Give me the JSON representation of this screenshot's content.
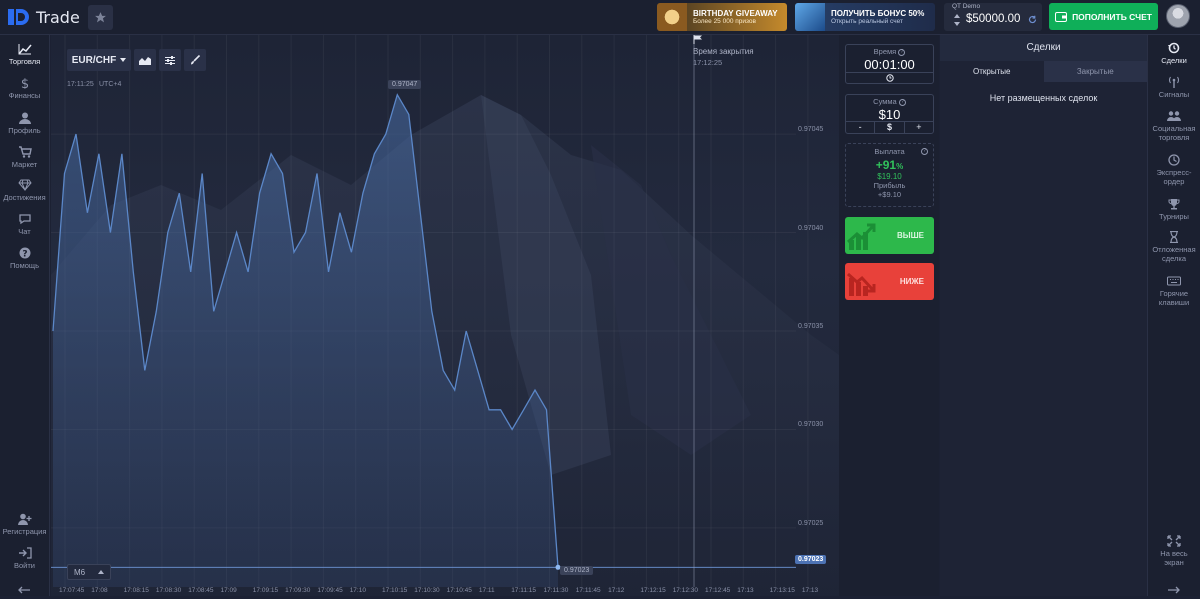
{
  "header": {
    "logo_text": "Trade",
    "promo1": {
      "title": "BIRTHDAY GIVEAWAY",
      "subtitle": "Более 25 000 призов"
    },
    "promo2": {
      "title": "ПОЛУЧИТЬ БОНУС 50%",
      "subtitle": "Открыть реальный счет"
    },
    "account_type": "QT Demo",
    "balance": "$50000.00",
    "deposit_label": "ПОПОЛНИТЬ СЧЕТ"
  },
  "left_nav": [
    {
      "label": "Торговля",
      "icon": "chart-icon",
      "active": true
    },
    {
      "label": "Финансы",
      "icon": "dollar-icon"
    },
    {
      "label": "Профиль",
      "icon": "user-icon"
    },
    {
      "label": "Маркет",
      "icon": "cart-icon"
    },
    {
      "label": "Достижения",
      "icon": "diamond-icon"
    },
    {
      "label": "Чат",
      "icon": "chat-icon"
    },
    {
      "label": "Помощь",
      "icon": "help-icon"
    }
  ],
  "left_nav_bottom": [
    {
      "label": "Регистрация",
      "icon": "user-plus-icon"
    },
    {
      "label": "Войти",
      "icon": "login-icon"
    }
  ],
  "chart": {
    "asset": "EUR/CHF",
    "time": "17:11:25",
    "timezone": "UTC+4",
    "close_label": "Время закрытия",
    "close_time": "17:12:25",
    "high_tag": "0.97047",
    "low_tag": "0.97023",
    "current_price": "0.97023",
    "timeframe": "M6",
    "y_ticks": [
      "0.97045",
      "0.97040",
      "0.97035",
      "0.97030",
      "0.97025"
    ],
    "x_ticks": [
      "17:07:45",
      "17:08",
      "17:08:15",
      "17:08:30",
      "17:08:45",
      "17:09",
      "17:09:15",
      "17:09:30",
      "17:09:45",
      "17:10",
      "17:10:15",
      "17:10:30",
      "17:10:45",
      "17:11",
      "17:11:15",
      "17:11:30",
      "17:11:45",
      "17:12",
      "17:12:15",
      "17:12:30",
      "17:12:45",
      "17:13",
      "17:13:15",
      "17:13"
    ]
  },
  "chart_data": {
    "type": "area",
    "title": "EUR/CHF",
    "ylim": [
      0.97022,
      0.97048
    ],
    "series": [
      {
        "values": [
          0.97035,
          0.97043,
          0.97045,
          0.97041,
          0.97044,
          0.9704,
          0.97044,
          0.97038,
          0.97033,
          0.97036,
          0.9704,
          0.97042,
          0.97038,
          0.97043,
          0.97036,
          0.97038,
          0.9704,
          0.97038,
          0.97042,
          0.97044,
          0.97043,
          0.97039,
          0.9704,
          0.97043,
          0.97038,
          0.97041,
          0.97039,
          0.97042,
          0.97044,
          0.97045,
          0.97047,
          0.97046,
          0.97041,
          0.97036,
          0.97033,
          0.97032,
          0.97035,
          0.97033,
          0.97031,
          0.97031,
          0.9703,
          0.97031,
          0.97032,
          0.97031,
          0.97023
        ]
      }
    ]
  },
  "trade_panel": {
    "time_label": "Время",
    "time_value": "00:01:00",
    "amount_label": "Сумма",
    "amount_value": "$10",
    "minus": "-",
    "currency": "$",
    "plus": "+",
    "payout_label": "Выплата",
    "payout_percent": "+91",
    "payout_pct_sign": "%",
    "payout_amount": "$19.10",
    "profit_label": "Прибыль",
    "profit_value": "+$9.10",
    "up_label": "ВЫШЕ",
    "down_label": "НИЖЕ"
  },
  "deals": {
    "title": "Сделки",
    "tab_open": "Открытые",
    "tab_closed": "Закрытые",
    "empty_text": "Нет размещенных сделок"
  },
  "right_nav": [
    {
      "label": "Сделки",
      "icon": "history-icon",
      "active": true
    },
    {
      "label": "Сигналы",
      "icon": "signal-icon"
    },
    {
      "label": "Социальная торговля",
      "icon": "social-icon"
    },
    {
      "label": "Экспресс-ордер",
      "icon": "express-icon"
    },
    {
      "label": "Турниры",
      "icon": "trophy-icon"
    },
    {
      "label": "Отложенная сделка",
      "icon": "hourglass-icon"
    },
    {
      "label": "Горячие клавиши",
      "icon": "keyboard-icon"
    }
  ],
  "right_nav_bottom": {
    "label": "На весь экран",
    "icon": "fullscreen-icon"
  },
  "colors": {
    "up": "#2db84b",
    "down": "#e8413a",
    "accent": "#0faf59",
    "chart_line": "#5b87c8"
  }
}
